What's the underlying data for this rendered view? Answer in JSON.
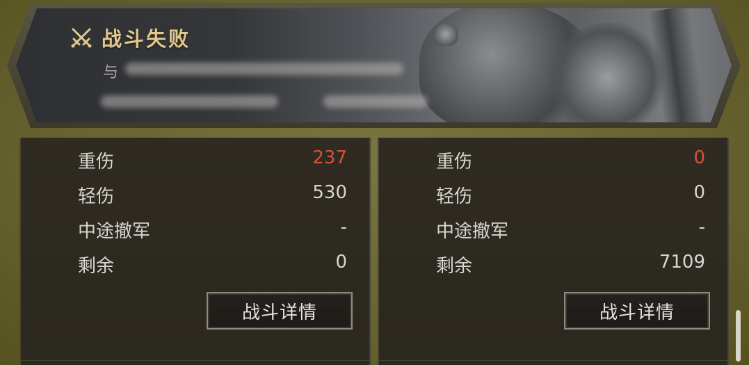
{
  "banner": {
    "title": "战斗失败",
    "subtitle_prefix": "与",
    "accent_color": "#e3c88b"
  },
  "left_panel": {
    "stats": [
      {
        "label": "重伤",
        "value": "237",
        "highlight": true
      },
      {
        "label": "轻伤",
        "value": "530",
        "highlight": false
      },
      {
        "label": "中途撤军",
        "value": "-",
        "highlight": false
      },
      {
        "label": "剩余",
        "value": "0",
        "highlight": false
      }
    ],
    "detail_button": "战斗详情"
  },
  "right_panel": {
    "stats": [
      {
        "label": "重伤",
        "value": "0",
        "highlight": true
      },
      {
        "label": "轻伤",
        "value": "0",
        "highlight": false
      },
      {
        "label": "中途撤军",
        "value": "-",
        "highlight": false
      },
      {
        "label": "剩余",
        "value": "7109",
        "highlight": false
      }
    ],
    "detail_button": "战斗详情"
  },
  "colors": {
    "highlight_value": "#d65236",
    "text": "#d8d6cf",
    "frame": "#6e6a34"
  }
}
